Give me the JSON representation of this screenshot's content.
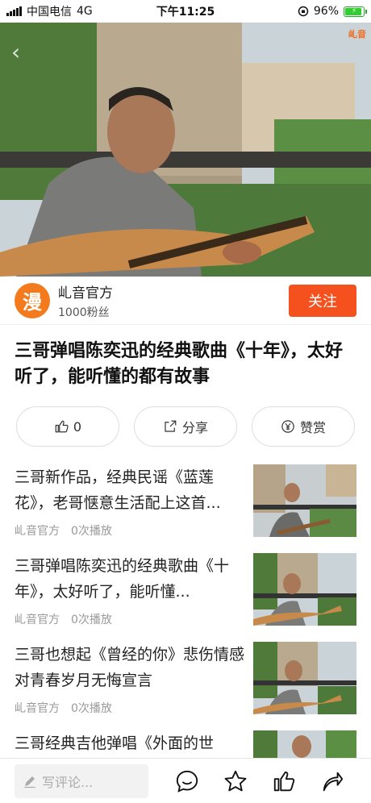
{
  "status_bar": {
    "carrier": "中国电信",
    "network": "4G",
    "time": "下午11:25",
    "battery": "96%"
  },
  "video": {
    "watermark": "乢音"
  },
  "author": {
    "avatar_char": "漫",
    "name": "乢音官方",
    "fans": "1000粉丝",
    "follow_label": "关注"
  },
  "title": "三哥弹唱陈奕迅的经典歌曲《十年》，太好听了，能听懂的都有故事",
  "actions": {
    "like_count": "0",
    "share_label": "分享",
    "reward_label": "赞赏"
  },
  "recommendations": [
    {
      "title": "三哥新作品，经典民谣《蓝莲花》，老哥惬意生活配上这首...",
      "author": "乢音官方",
      "plays": "0次播放"
    },
    {
      "title": "三哥弹唱陈奕迅的经典歌曲《十年》，太好听了，能听懂...",
      "author": "乢音官方",
      "plays": "0次播放"
    },
    {
      "title": "三哥也想起《曾经的你》悲伤情感 对青春岁月无悔宣言",
      "author": "乢音官方",
      "plays": "0次播放"
    },
    {
      "title": "三哥经典吉他弹唱《外面的世",
      "author": "",
      "plays": ""
    }
  ],
  "bottom_bar": {
    "comment_placeholder": "写评论..."
  }
}
